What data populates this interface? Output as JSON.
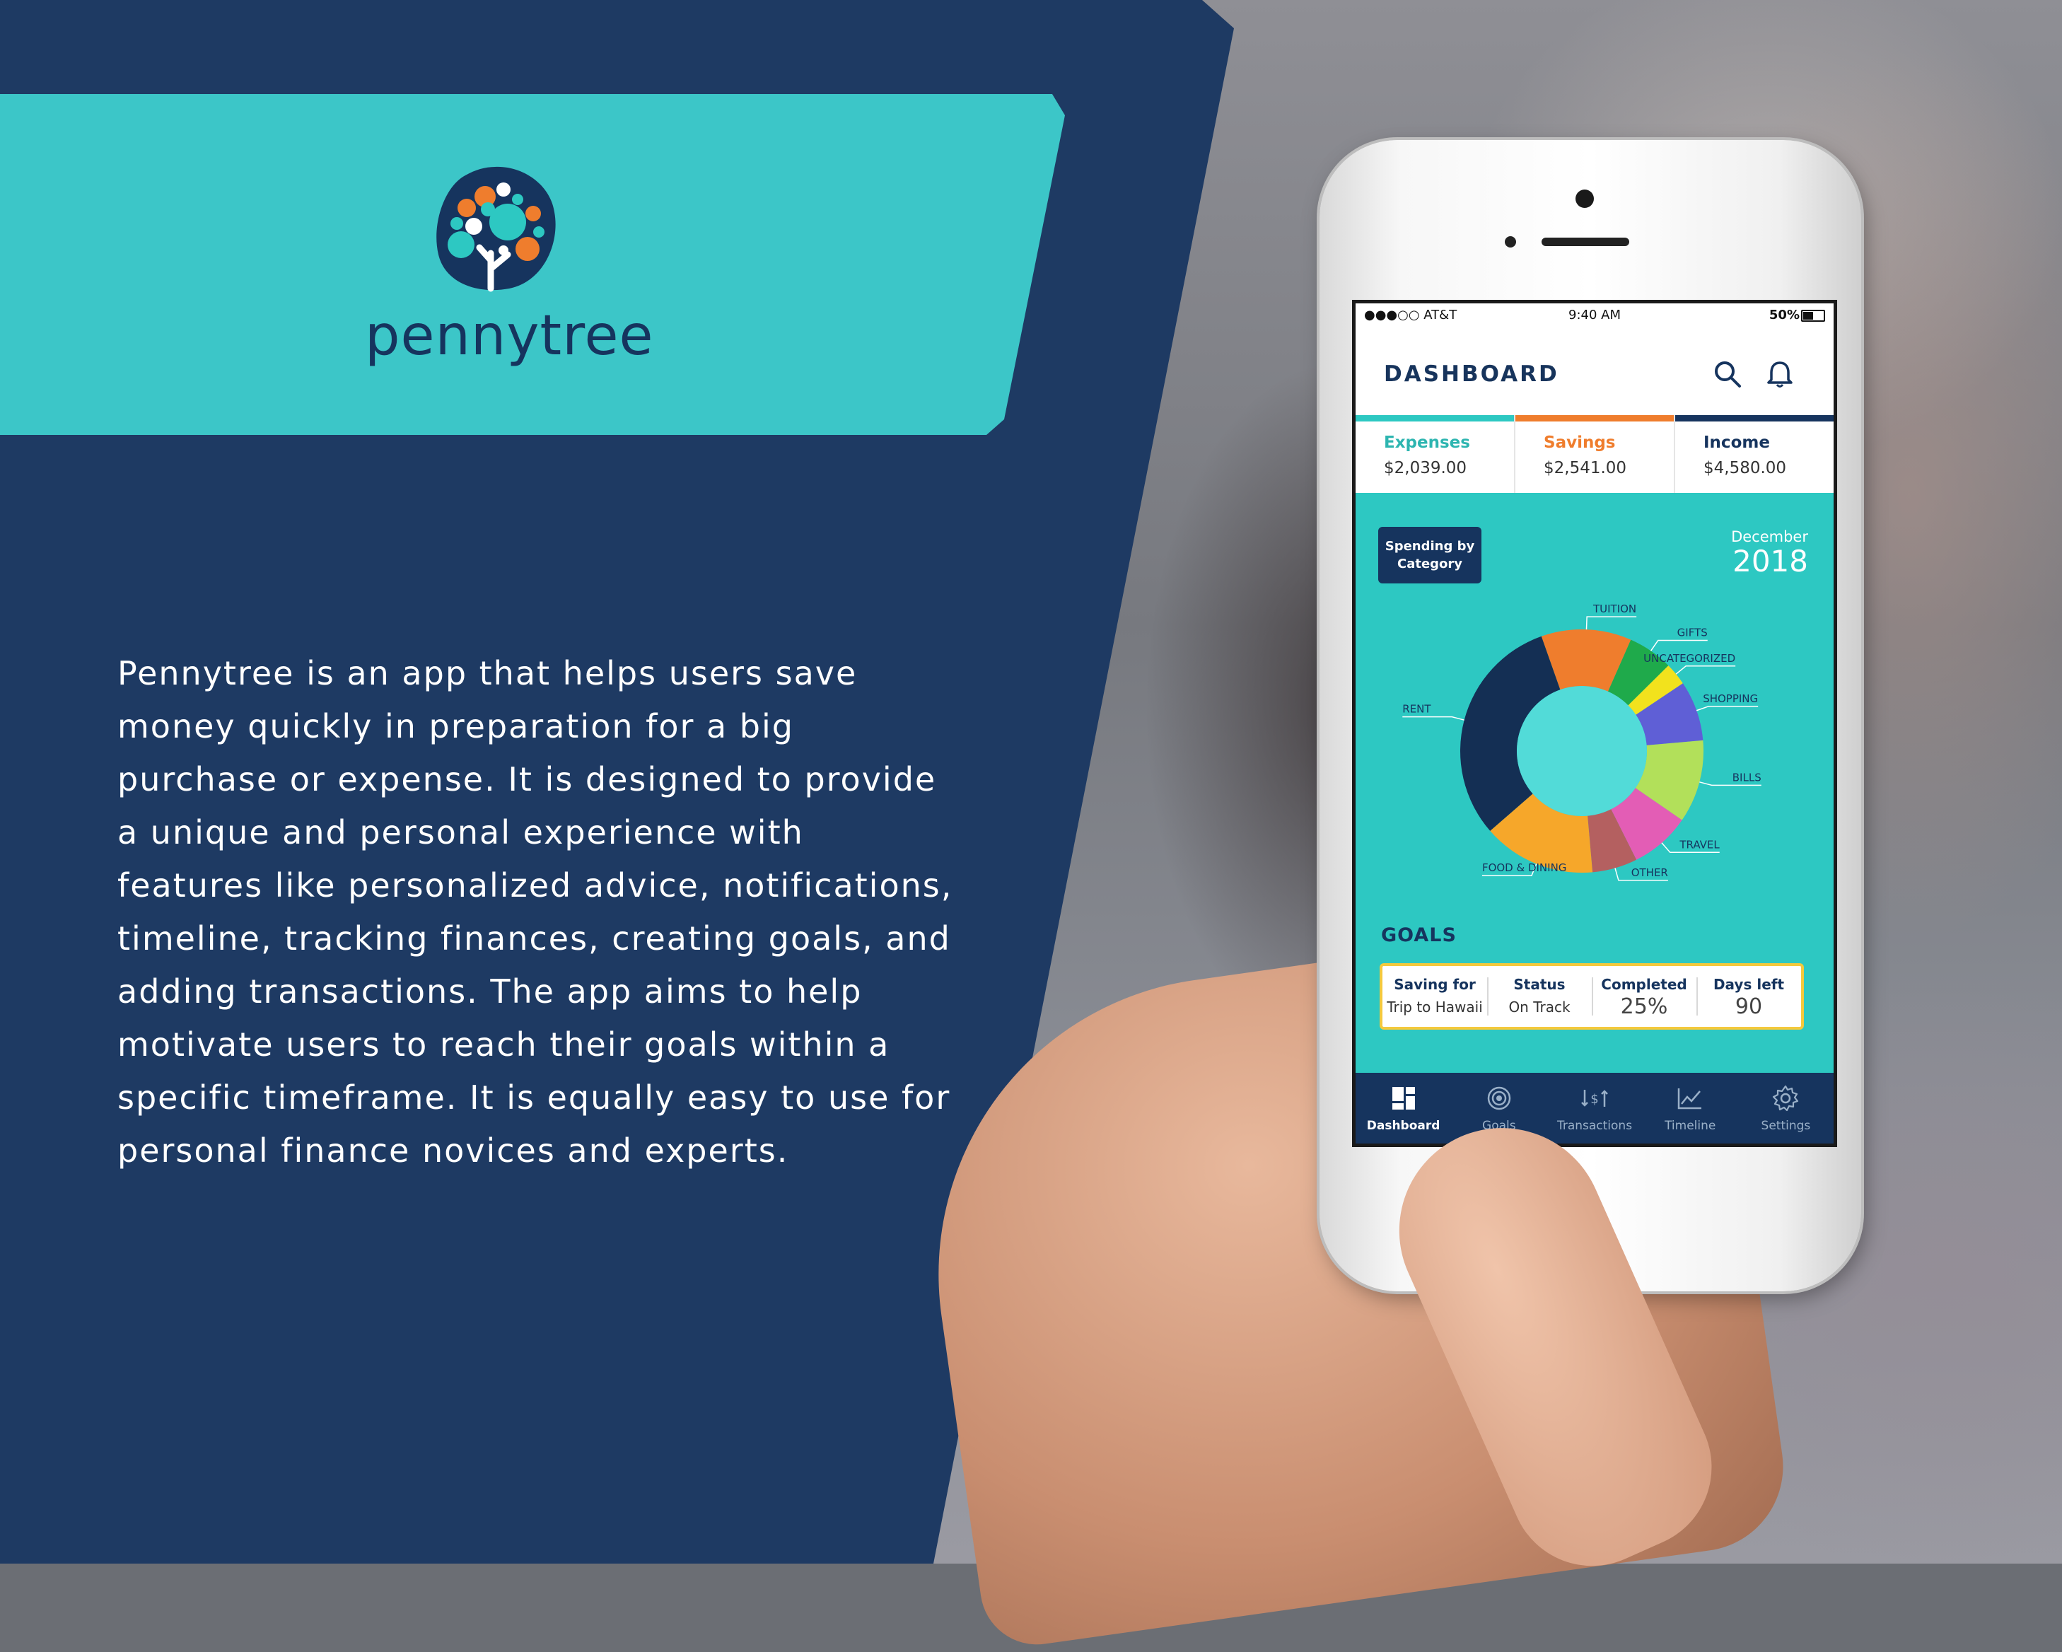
{
  "brand": {
    "name": "pennytree",
    "logo_icon": "tree-logo-icon",
    "colors": {
      "navy": "#1e3a63",
      "teal": "#3cc6c8",
      "orange": "#ef7d2d"
    }
  },
  "description_lines": [
    "Pennytree is an app that helps users save",
    "money quickly in preparation for a big",
    "purchase or expense. It is designed to provide",
    "a unique and personal experience with",
    "features like personalized advice, notifications,",
    "timeline, tracking finances, creating goals, and",
    "adding transactions. The app aims to help",
    "motivate users to reach their goals within a",
    "specific timeframe. It is equally easy to use for",
    "personal finance novices and experts."
  ],
  "status_bar": {
    "carrier": "●●●○○ AT&T",
    "time": "9:40 AM",
    "battery": "50%"
  },
  "app": {
    "title": "DASHBOARD",
    "header_icons": [
      "search-icon",
      "bell-icon"
    ],
    "summary": [
      {
        "label": "Expenses",
        "value": "$2,039.00",
        "color": "#2dc8c2"
      },
      {
        "label": "Savings",
        "value": "$2,541.00",
        "color": "#ef7d2d"
      },
      {
        "label": "Income",
        "value": "$4,580.00",
        "color": "#16345e"
      }
    ],
    "chip": {
      "line1": "Spending by",
      "line2": "Category"
    },
    "month": "December",
    "year": "2018",
    "goals": {
      "title": "GOALS",
      "columns": [
        {
          "header": "Saving for",
          "value": "Trip to Hawaii"
        },
        {
          "header": "Status",
          "value": "On Track"
        },
        {
          "header": "Completed",
          "value": "25%"
        },
        {
          "header": "Days left",
          "value": "90"
        }
      ]
    },
    "tabs": [
      {
        "label": "Dashboard",
        "icon": "dashboard-icon",
        "active": true
      },
      {
        "label": "Goals",
        "icon": "target-icon",
        "active": false
      },
      {
        "label": "Transactions",
        "icon": "transactions-icon",
        "active": false
      },
      {
        "label": "Timeline",
        "icon": "timeline-chart-icon",
        "active": false
      },
      {
        "label": "Settings",
        "icon": "gear-icon",
        "active": false
      }
    ]
  },
  "chart_data": {
    "type": "pie",
    "title": "",
    "categories": [
      "TUITION",
      "GIFTS",
      "UNCATEGORIZED",
      "SHOPPING",
      "BILLS",
      "TRAVEL",
      "OTHER",
      "FOOD & DINING",
      "RENT"
    ],
    "values": [
      12,
      6,
      3,
      8,
      11,
      8,
      6,
      15,
      31
    ],
    "colors": [
      "#ef7d2d",
      "#1faa4b",
      "#f2e21d",
      "#5f5fd6",
      "#b2e05a",
      "#e35db5",
      "#b46060",
      "#f6a72a",
      "#142f54"
    ]
  }
}
